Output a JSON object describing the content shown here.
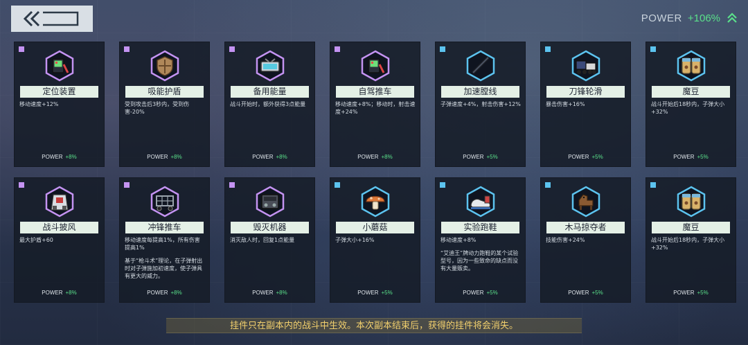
{
  "header": {
    "power_label": "POWER",
    "power_value": "+106%"
  },
  "colors": {
    "rarity_purple": "#c493f2",
    "rarity_blue": "#5cc3ef",
    "power_green": "#5ae08a",
    "tip_text": "#f1cf6d"
  },
  "cards": [
    {
      "name": "定位装置",
      "rarity": "purple",
      "icon": "gps-device-icon",
      "desc": "移动速度+12%",
      "extra": "",
      "power_label": "POWER",
      "power_value": "+8%"
    },
    {
      "name": "吸能护盾",
      "rarity": "purple",
      "icon": "shield-icon",
      "desc": "受到攻击后3秒内，受到伤害-20%",
      "extra": "",
      "power_label": "POWER",
      "power_value": "+8%"
    },
    {
      "name": "备用能量",
      "rarity": "purple",
      "icon": "battery-icon",
      "desc": "战斗开始时，额外获得3点能量",
      "extra": "",
      "power_label": "POWER",
      "power_value": "+8%"
    },
    {
      "name": "自驾推车",
      "rarity": "purple",
      "icon": "gps-device-icon",
      "desc": "移动速度+8%；移动时，射击速度+24%",
      "extra": "",
      "power_label": "POWER",
      "power_value": "+8%"
    },
    {
      "name": "加速膛线",
      "rarity": "blue",
      "icon": "rifle-barrel-icon",
      "desc": "子弹速度+4%，射击伤害+12%",
      "extra": "",
      "power_label": "POWER",
      "power_value": "+5%"
    },
    {
      "name": "刀锋轮滑",
      "rarity": "blue",
      "icon": "blade-skates-icon",
      "desc": "暴击伤害+16%",
      "extra": "",
      "power_label": "POWER",
      "power_value": "+5%"
    },
    {
      "name": "魔豆",
      "rarity": "blue",
      "icon": "magic-bean-jar-icon",
      "desc": "战斗开始后18秒内，子弹大小+32%",
      "extra": "",
      "power_label": "POWER",
      "power_value": "+5%"
    },
    {
      "name": "战斗披风",
      "rarity": "purple",
      "icon": "cape-icon",
      "desc": "最大护盾+60",
      "extra": "",
      "power_label": "POWER",
      "power_value": "+8%"
    },
    {
      "name": "冲锋推车",
      "rarity": "purple",
      "icon": "cart-icon",
      "desc": "移动速度每提高1%，所有伤害提高1%",
      "extra": "基于“枪斗术”理论，在子弹射出时对子弹施加初速度，使子弹具有更大的威力。",
      "power_label": "POWER",
      "power_value": "+8%"
    },
    {
      "name": "毁灭机器",
      "rarity": "purple",
      "icon": "machine-icon",
      "desc": "消灭敌人时，回复1点能量",
      "extra": "",
      "power_label": "POWER",
      "power_value": "+8%"
    },
    {
      "name": "小蘑菇",
      "rarity": "blue",
      "icon": "mushroom-icon",
      "desc": "子弹大小+16%",
      "extra": "",
      "power_label": "POWER",
      "power_value": "+5%"
    },
    {
      "name": "实验跑鞋",
      "rarity": "blue",
      "icon": "running-shoe-icon",
      "desc": "移动速度+8%",
      "extra": "“艾迪王”牌动力跑鞋的某个试验型号，因为一些致命的缺点而没有大量贩卖。",
      "power_label": "POWER",
      "power_value": "+5%"
    },
    {
      "name": "木马掠夺者",
      "rarity": "blue",
      "icon": "wooden-horse-icon",
      "desc": "技能伤害+24%",
      "extra": "",
      "power_label": "POWER",
      "power_value": "+5%"
    },
    {
      "name": "魔豆",
      "rarity": "blue",
      "icon": "magic-bean-jar-icon",
      "desc": "战斗开始后18秒内，子弹大小+32%",
      "extra": "",
      "power_label": "POWER",
      "power_value": "+5%"
    }
  ],
  "tip": "挂件只在副本内的战斗中生效。本次副本结束后，获得的挂件将会消失。"
}
